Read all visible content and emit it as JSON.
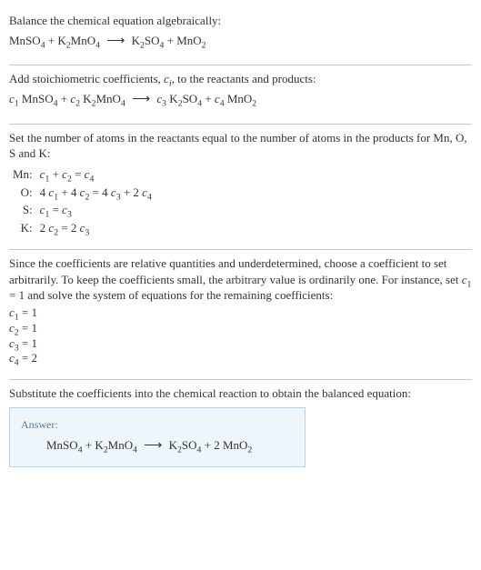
{
  "s1": {
    "title": "Balance the chemical equation algebraically:",
    "lhs1": "MnSO",
    "lhs1s": "4",
    "plus": " + ",
    "lhs2": "K",
    "lhs2s": "2",
    "lhs2b": "MnO",
    "lhs2bs": "4",
    "rhs1": "K",
    "rhs1s": "2",
    "rhs1b": "SO",
    "rhs1bs": "4",
    "rhs2": "MnO",
    "rhs2s": "2"
  },
  "s2": {
    "line": "Add stoichiometric coefficients, ",
    "ci": "c",
    "cisub": "i",
    "line2": ", to the reactants and products:",
    "c1": "c",
    "c1s": "1",
    "sp": " ",
    "t1": "MnSO",
    "t1s": "4",
    "c2": "c",
    "c2s": "2",
    "t2a": "K",
    "t2as": "2",
    "t2b": "MnO",
    "t2bs": "4",
    "c3": "c",
    "c3s": "3",
    "t3a": "K",
    "t3as": "2",
    "t3b": "SO",
    "t3bs": "4",
    "c4": "c",
    "c4s": "4",
    "t4": "MnO",
    "t4s": "2"
  },
  "s3": {
    "text": "Set the number of atoms in the reactants equal to the number of atoms in the products for Mn, O, S and K:",
    "rows": [
      {
        "lbl": "Mn:",
        "eq": "c1 + c2 = c4",
        "html": "<span class='ital'>c</span><sub>1</sub> + <span class='ital'>c</span><sub>2</sub> = <span class='ital'>c</span><sub>4</sub>"
      },
      {
        "lbl": "O:",
        "eq": "4 c1 + 4 c2 = 4 c3 + 2 c4",
        "html": "4 <span class='ital'>c</span><sub>1</sub> + 4 <span class='ital'>c</span><sub>2</sub> = 4 <span class='ital'>c</span><sub>3</sub> + 2 <span class='ital'>c</span><sub>4</sub>"
      },
      {
        "lbl": "S:",
        "eq": "c1 = c3",
        "html": "<span class='ital'>c</span><sub>1</sub> = <span class='ital'>c</span><sub>3</sub>"
      },
      {
        "lbl": "K:",
        "eq": "2 c2 = 2 c3",
        "html": "2 <span class='ital'>c</span><sub>2</sub> = 2 <span class='ital'>c</span><sub>3</sub>"
      }
    ]
  },
  "s4": {
    "p1": "Since the coefficients are relative quantities and underdetermined, choose a coefficient to set arbitrarily. To keep the coefficients small, the arbitrary value is ordinarily one. For instance, set ",
    "c1": "c",
    "c1s": "1",
    "p2": " = 1 and solve the system of equations for the remaining coefficients:",
    "vals": [
      {
        "c": "c",
        "s": "1",
        "v": " = 1"
      },
      {
        "c": "c",
        "s": "2",
        "v": " = 1"
      },
      {
        "c": "c",
        "s": "3",
        "v": " = 1"
      },
      {
        "c": "c",
        "s": "4",
        "v": " = 2"
      }
    ]
  },
  "s5": {
    "text": "Substitute the coefficients into the chemical reaction to obtain the balanced equation:",
    "answer_label": "Answer:",
    "lhs1": "MnSO",
    "lhs1s": "4",
    "lhs2a": "K",
    "lhs2as": "2",
    "lhs2b": "MnO",
    "lhs2bs": "4",
    "rhs1a": "K",
    "rhs1as": "2",
    "rhs1b": "SO",
    "rhs1bs": "4",
    "two": "2 ",
    "rhs2": "MnO",
    "rhs2s": "2"
  },
  "sym": {
    "plus": " + ",
    "arrow": "⟶"
  }
}
